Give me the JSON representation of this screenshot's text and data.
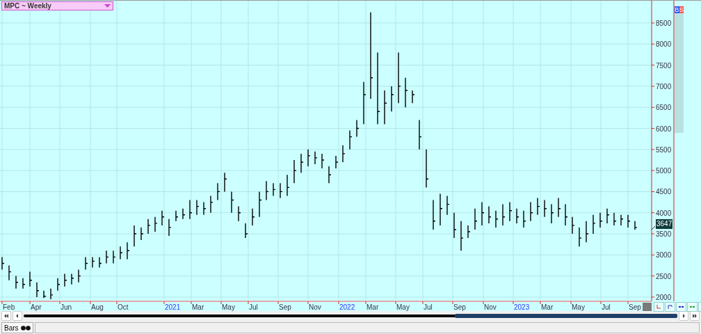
{
  "chart_header": {
    "title": "MPC ~ Weekly"
  },
  "side_badges": [
    "B",
    "S"
  ],
  "chart": {
    "y_axis_labels": [
      "8500",
      "8000",
      "7500",
      "7000",
      "6500",
      "6000",
      "5500",
      "5000",
      "4500",
      "4000",
      "3500",
      "3000",
      "2500",
      "2000"
    ],
    "x_axis_labels": [
      {
        "label": "Feb",
        "year": false
      },
      {
        "label": "Apr",
        "year": false
      },
      {
        "label": "Jun",
        "year": false
      },
      {
        "label": "Aug",
        "year": false
      },
      {
        "label": "Oct",
        "year": false
      },
      {
        "label": "2021",
        "year": true
      },
      {
        "label": "Mar",
        "year": false
      },
      {
        "label": "May",
        "year": false
      },
      {
        "label": "Jul",
        "year": false
      },
      {
        "label": "Sep",
        "year": false
      },
      {
        "label": "Nov",
        "year": false
      },
      {
        "label": "2022",
        "year": true
      },
      {
        "label": "Mar",
        "year": false
      },
      {
        "label": "May",
        "year": false
      },
      {
        "label": "Jul",
        "year": false
      },
      {
        "label": "Sep",
        "year": false
      },
      {
        "label": "Nov",
        "year": false
      },
      {
        "label": "2023",
        "year": true
      },
      {
        "label": "Mar",
        "year": false
      },
      {
        "label": "May",
        "year": false
      },
      {
        "label": "Jul",
        "year": false
      },
      {
        "label": "Sep",
        "year": false
      }
    ],
    "last_price": "3647"
  },
  "bottom_tabs": [
    {
      "label": "Bars",
      "selected": true
    }
  ]
}
